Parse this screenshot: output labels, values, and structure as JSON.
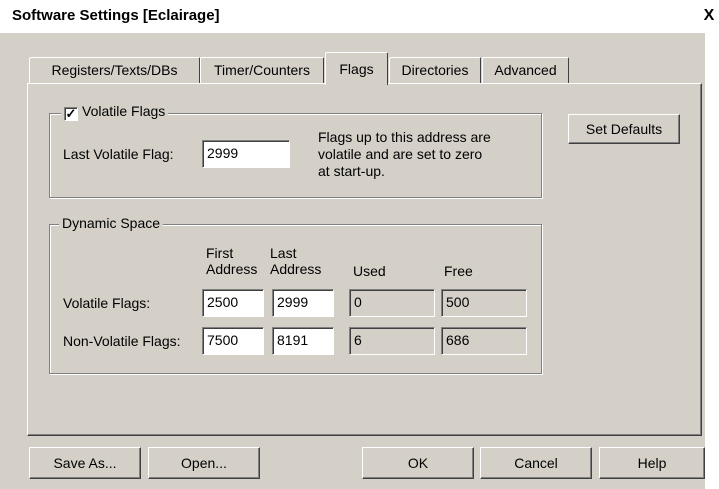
{
  "window": {
    "title": "Software Settings [Eclairage]",
    "close_glyph": "X"
  },
  "tabs": [
    {
      "label": "Registers/Texts/DBs",
      "active": false
    },
    {
      "label": "Timer/Counters",
      "active": false
    },
    {
      "label": "Flags",
      "active": true
    },
    {
      "label": "Directories",
      "active": false
    },
    {
      "label": "Advanced",
      "active": false
    }
  ],
  "volatile_flags": {
    "group_label": "Volatile Flags",
    "checked": true,
    "check_glyph": "✓",
    "last_label": "Last Volatile Flag:",
    "last_value": "2999",
    "note_lines": [
      "Flags up to this address are",
      "volatile and are set to zero",
      "at start-up."
    ]
  },
  "set_defaults_label": "Set Defaults",
  "dynamic_space": {
    "group_label": "Dynamic Space",
    "headers": {
      "first_1": "First",
      "first_2": "Address",
      "last_1": "Last",
      "last_2": "Address",
      "used": "Used",
      "free": "Free"
    },
    "rows": [
      {
        "label": "Volatile Flags:",
        "first": "2500",
        "last": "2999",
        "used": "0",
        "free": "500"
      },
      {
        "label": "Non-Volatile Flags:",
        "first": "7500",
        "last": "8191",
        "used": "6",
        "free": "686"
      }
    ]
  },
  "buttons": {
    "save_as": "Save As...",
    "open": "Open...",
    "ok": "OK",
    "cancel": "Cancel",
    "help": "Help"
  }
}
